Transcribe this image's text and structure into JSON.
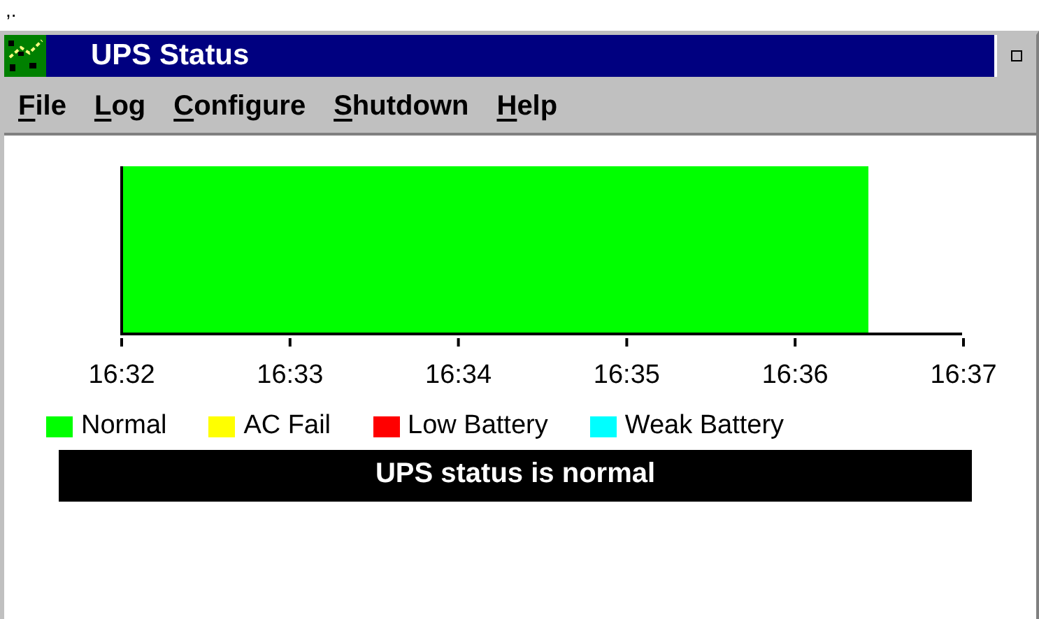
{
  "stray_text": ",.",
  "window": {
    "title": "UPS Status"
  },
  "menu": [
    {
      "label": "File"
    },
    {
      "label": "Log"
    },
    {
      "label": "Configure"
    },
    {
      "label": "Shutdown"
    },
    {
      "label": "Help"
    }
  ],
  "timeline": {
    "span": {
      "level": 0.888
    },
    "ticks": [
      "16:32",
      "16:33",
      "16:34",
      "16:35",
      "16:36",
      "16:37"
    ]
  },
  "legend": [
    {
      "label": "Normal",
      "color": "#00ff00"
    },
    {
      "label": "AC Fail",
      "color": "#ffff00"
    },
    {
      "label": "Low Battery",
      "color": "#ff0000"
    },
    {
      "label": "Weak Battery",
      "color": "#00ffff"
    }
  ],
  "status_message": "UPS status is normal"
}
